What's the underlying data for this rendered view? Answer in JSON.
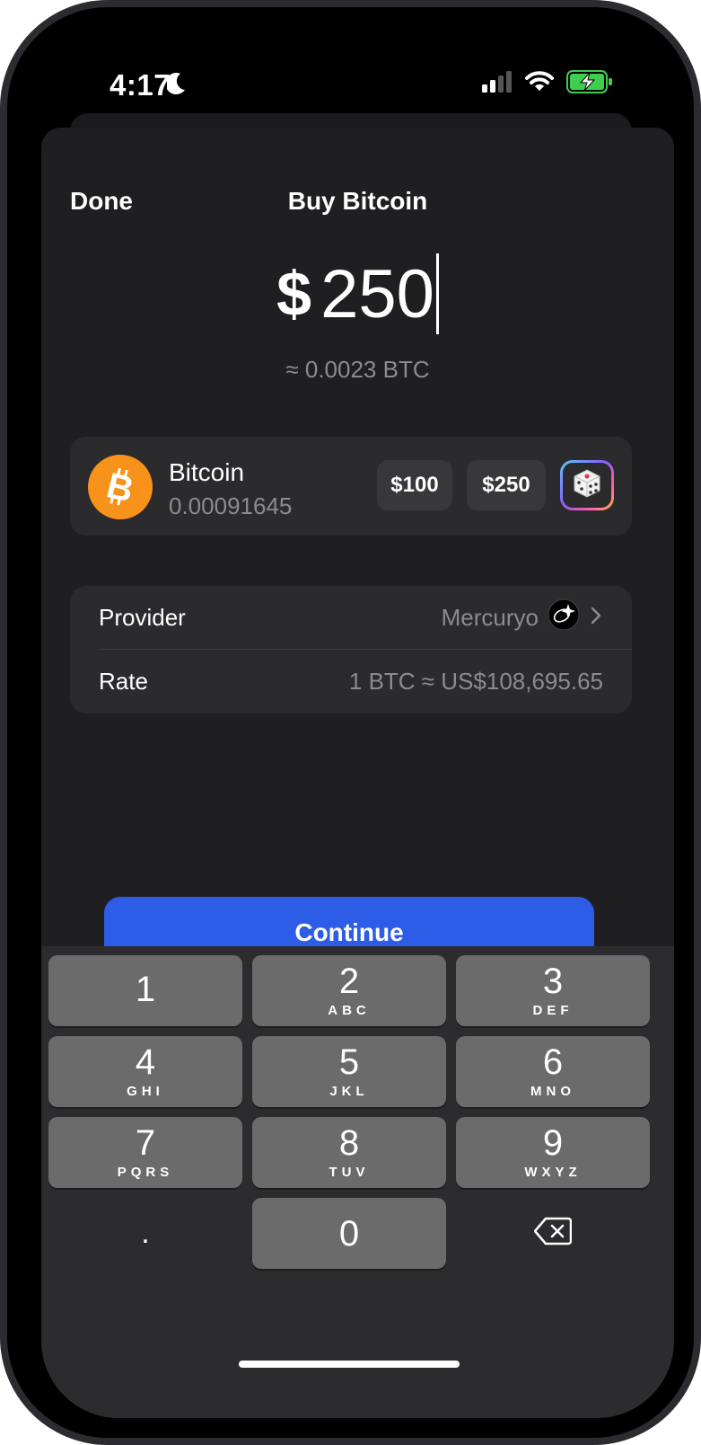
{
  "status": {
    "time": "4:17"
  },
  "header": {
    "done_label": "Done",
    "title": "Buy Bitcoin"
  },
  "amount": {
    "currency_symbol": "$",
    "value": "250",
    "btc_equivalent": "≈ 0.0023 BTC"
  },
  "asset": {
    "name": "Bitcoin",
    "balance": "0.00091645",
    "presets": [
      "$100",
      "$250"
    ],
    "logo_icon": "bitcoin-logo",
    "random_icon": "dice-icon"
  },
  "info": {
    "provider_label": "Provider",
    "provider_value": "Mercuryo",
    "rate_label": "Rate",
    "rate_value": "1 BTC ≈ US$108,695.65"
  },
  "continue_label": "Continue",
  "keypad": {
    "keys": [
      {
        "digit": "1",
        "letters": ""
      },
      {
        "digit": "2",
        "letters": "ABC"
      },
      {
        "digit": "3",
        "letters": "DEF"
      },
      {
        "digit": "4",
        "letters": "GHI"
      },
      {
        "digit": "5",
        "letters": "JKL"
      },
      {
        "digit": "6",
        "letters": "MNO"
      },
      {
        "digit": "7",
        "letters": "PQRS"
      },
      {
        "digit": "8",
        "letters": "TUV"
      },
      {
        "digit": "9",
        "letters": "WXYZ"
      },
      {
        "digit": "0",
        "letters": ""
      }
    ],
    "decimal": "."
  },
  "colors": {
    "accent": "#2d5ce6",
    "bitcoin": "#f7931a",
    "sheet_bg": "#1f1f21",
    "card_bg": "#2b2b2e"
  }
}
